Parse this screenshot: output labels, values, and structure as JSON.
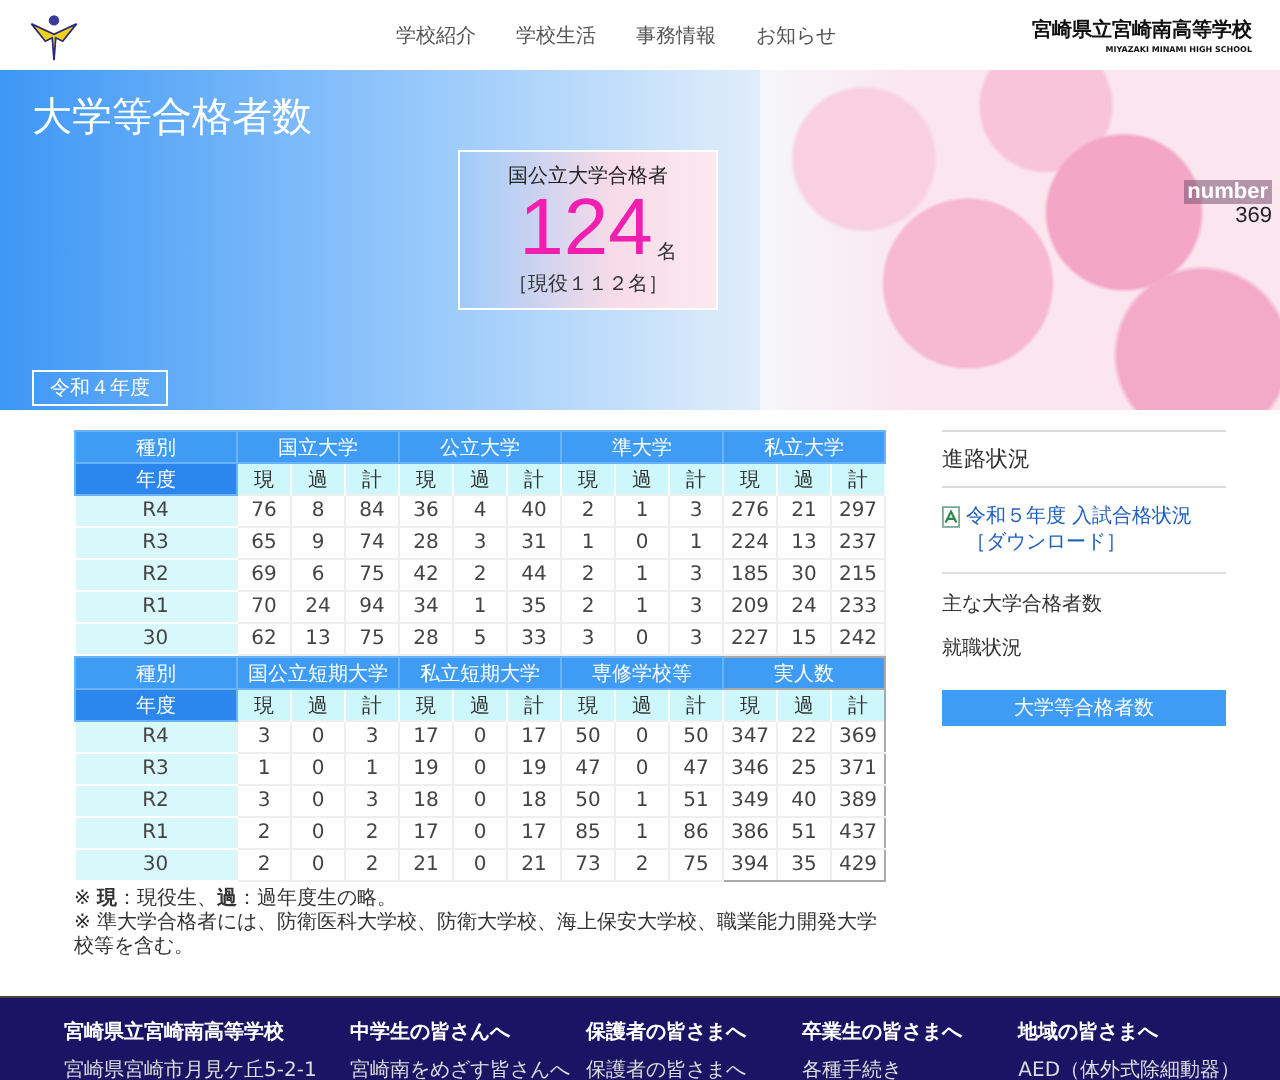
{
  "header": {
    "nav": [
      "学校紹介",
      "学校生活",
      "事務情報",
      "お知らせ"
    ],
    "school_name": "宮崎県立宮崎南高等学校",
    "school_name_en": "MIYAZAKI MINAMI HIGH SCHOOL"
  },
  "hero": {
    "title": "大学等合格者数",
    "card": {
      "title": "国公立大学合格者",
      "number": "124",
      "unit": "名",
      "note": "［現役１１２名］"
    },
    "counter": {
      "label": "number",
      "value": "369"
    },
    "year_button": "令和４年度"
  },
  "tables": [
    {
      "corner_top": "種別",
      "corner_bottom": "年度",
      "groups": [
        {
          "name": "国立大学",
          "outlined": false,
          "subcolumns": [
            "現",
            "過",
            "計"
          ]
        },
        {
          "name": "公立大学",
          "outlined": false,
          "subcolumns": [
            "現",
            "過",
            "計"
          ]
        },
        {
          "name": "準大学",
          "outlined": false,
          "subcolumns": [
            "現",
            "過",
            "計"
          ]
        },
        {
          "name": "私立大学",
          "outlined": false,
          "subcolumns": [
            "現",
            "過",
            "計"
          ]
        }
      ],
      "rows": [
        {
          "year": "R4",
          "cells": [
            "76",
            "8",
            "84",
            "36",
            "4",
            "40",
            "2",
            "1",
            "3",
            "276",
            "21",
            "297"
          ]
        },
        {
          "year": "R3",
          "cells": [
            "65",
            "9",
            "74",
            "28",
            "3",
            "31",
            "1",
            "0",
            "1",
            "224",
            "13",
            "237"
          ]
        },
        {
          "year": "R2",
          "cells": [
            "69",
            "6",
            "75",
            "42",
            "2",
            "44",
            "2",
            "1",
            "3",
            "185",
            "30",
            "215"
          ]
        },
        {
          "year": "R1",
          "cells": [
            "70",
            "24",
            "94",
            "34",
            "1",
            "35",
            "2",
            "1",
            "3",
            "209",
            "24",
            "233"
          ]
        },
        {
          "year": "30",
          "cells": [
            "62",
            "13",
            "75",
            "28",
            "5",
            "33",
            "3",
            "0",
            "3",
            "227",
            "15",
            "242"
          ]
        }
      ]
    },
    {
      "corner_top": "種別",
      "corner_bottom": "年度",
      "groups": [
        {
          "name": "国公立短期大学",
          "outlined": false,
          "subcolumns": [
            "現",
            "過",
            "計"
          ]
        },
        {
          "name": "私立短期大学",
          "outlined": false,
          "subcolumns": [
            "現",
            "過",
            "計"
          ]
        },
        {
          "name": "専修学校等",
          "outlined": false,
          "subcolumns": [
            "現",
            "過",
            "計"
          ]
        },
        {
          "name": "実人数",
          "outlined": true,
          "subcolumns": [
            "現",
            "過",
            "計"
          ]
        }
      ],
      "rows": [
        {
          "year": "R4",
          "cells": [
            "3",
            "0",
            "3",
            "17",
            "0",
            "17",
            "50",
            "0",
            "50",
            "347",
            "22",
            "369"
          ]
        },
        {
          "year": "R3",
          "cells": [
            "1",
            "0",
            "1",
            "19",
            "0",
            "19",
            "47",
            "0",
            "47",
            "346",
            "25",
            "371"
          ]
        },
        {
          "year": "R2",
          "cells": [
            "3",
            "0",
            "3",
            "18",
            "0",
            "18",
            "50",
            "1",
            "51",
            "349",
            "40",
            "389"
          ]
        },
        {
          "year": "R1",
          "cells": [
            "2",
            "0",
            "2",
            "17",
            "0",
            "17",
            "85",
            "1",
            "86",
            "386",
            "51",
            "437"
          ]
        },
        {
          "year": "30",
          "cells": [
            "2",
            "0",
            "2",
            "21",
            "0",
            "21",
            "73",
            "2",
            "75",
            "394",
            "35",
            "429"
          ]
        }
      ]
    }
  ],
  "notes": [
    "※ **現**：現役生、**過**：過年度生の略。",
    "※ 準大学合格者には、防衛医科大学校、防衛大学校、海上保安大学校、職業能力開発大学校等を含む。"
  ],
  "sidebar": {
    "title": "進路状況",
    "download_link": "令和５年度 入試合格状況［ダウンロード］",
    "items": [
      "主な大学合格者数",
      "就職状況"
    ],
    "button": "大学等合格者数"
  },
  "footer": {
    "school_name": "宮崎県立宮崎南高等学校",
    "address": "宮崎県宮崎市月見ケ丘5-2-1",
    "columns": [
      {
        "title": "中学生の皆さんへ",
        "link": "宮崎南をめざす皆さんへ"
      },
      {
        "title": "保護者の皆さまへ",
        "link": "保護者の皆さまへ"
      },
      {
        "title": "卒業生の皆さまへ",
        "link": "各種手続き"
      },
      {
        "title": "地域の皆さまへ",
        "link": "AED（体外式除細動器）"
      }
    ]
  }
}
